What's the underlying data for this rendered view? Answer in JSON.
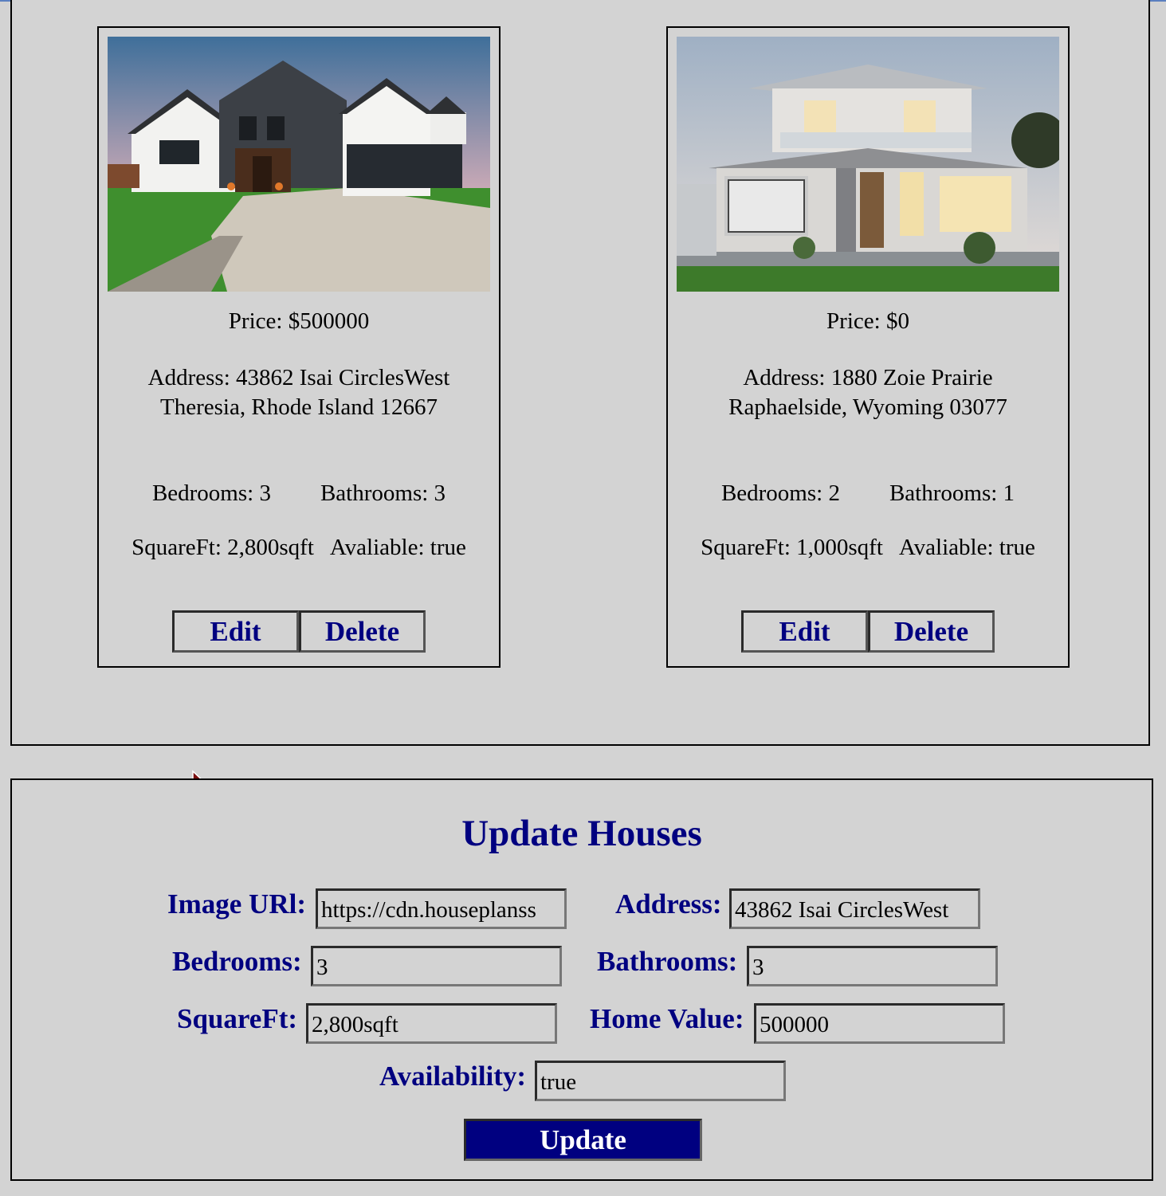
{
  "listings": [
    {
      "price": "Price: $500000",
      "address": "Address: 43862 Isai CirclesWest Theresia, Rhode Island 12667",
      "bedrooms": "Bedrooms: 3",
      "bathrooms": "Bathrooms: 3",
      "squareft": "SquareFt: 2,800sqft",
      "available": "Avaliable: true",
      "edit_label": "Edit",
      "delete_label": "Delete"
    },
    {
      "price": "Price: $0",
      "address": "Address: 1880 Zoie Prairie Raphaelside, Wyoming 03077",
      "bedrooms": "Bedrooms: 2",
      "bathrooms": "Bathrooms: 1",
      "squareft": "SquareFt: 1,000sqft",
      "available": "Avaliable: true",
      "edit_label": "Edit",
      "delete_label": "Delete"
    }
  ],
  "update_form": {
    "title": "Update Houses",
    "image_url_label": "Image URl:",
    "image_url_value": "https://cdn.houseplanss",
    "address_label": "Address:",
    "address_value": "43862 Isai CirclesWest",
    "bedrooms_label": "Bedrooms:",
    "bedrooms_value": "3",
    "bathrooms_label": "Bathrooms:",
    "bathrooms_value": "3",
    "squareft_label": "SquareFt:",
    "squareft_value": "2,800sqft",
    "home_value_label": "Home Value:",
    "home_value_value": "500000",
    "availability_label": "Availability:",
    "availability_value": "true",
    "update_label": "Update"
  },
  "colors": {
    "background": "#d3d3d3",
    "accent": "#000080",
    "border": "#000000"
  }
}
